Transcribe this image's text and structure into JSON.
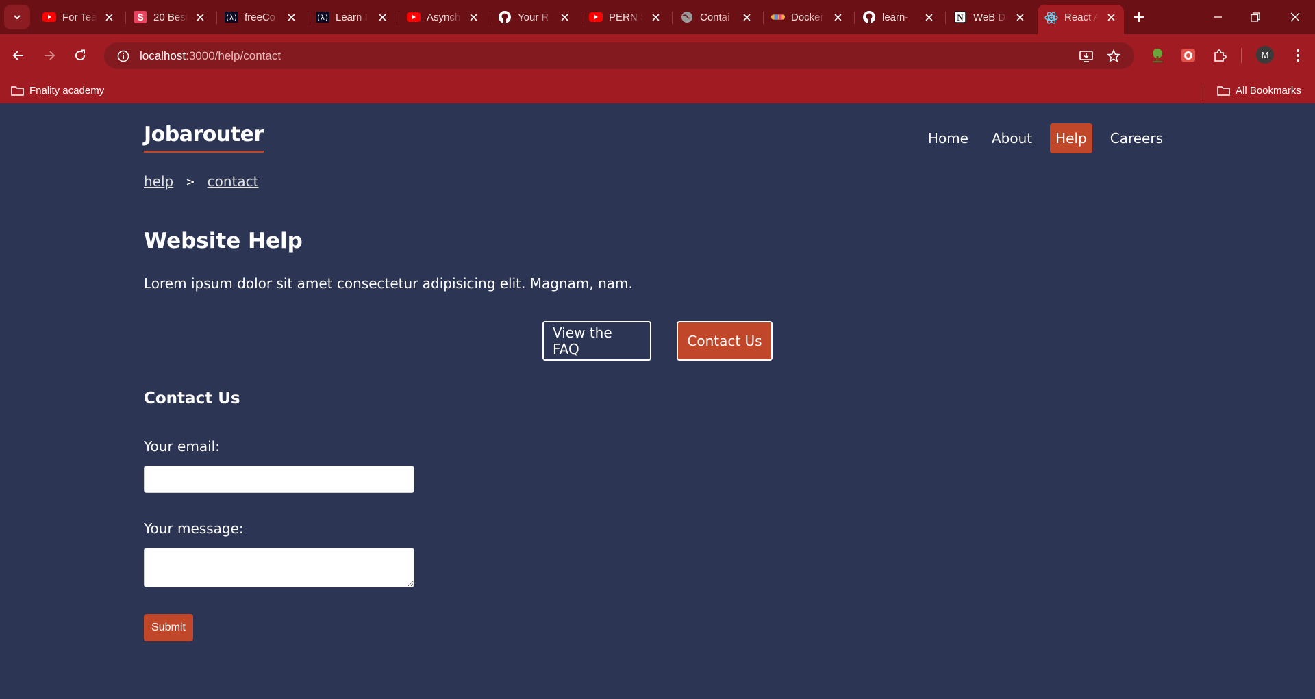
{
  "browser": {
    "tabs": [
      {
        "title": "For Tea",
        "icon": "youtube-icon"
      },
      {
        "title": "20 Best",
        "icon": "s-logo-icon"
      },
      {
        "title": "freeCo",
        "icon": "freecodecamp-icon"
      },
      {
        "title": "Learn I",
        "icon": "freecodecamp-icon"
      },
      {
        "title": "Asynch",
        "icon": "youtube-icon"
      },
      {
        "title": "Your R",
        "icon": "github-icon"
      },
      {
        "title": "PERN S",
        "icon": "youtube-icon"
      },
      {
        "title": "Contai",
        "icon": "globe-icon"
      },
      {
        "title": "Docker",
        "icon": "docker-icon"
      },
      {
        "title": "learn-",
        "icon": "github-icon"
      },
      {
        "title": "WeB D",
        "icon": "notion-icon"
      },
      {
        "title": "React A",
        "icon": "react-icon",
        "active": true
      }
    ],
    "url_host": "localhost",
    "url_path": ":3000/help/contact",
    "profile_initial": "M",
    "bookmark_folder": "Fnality academy",
    "all_bookmarks": "All Bookmarks"
  },
  "site": {
    "brand": "Jobarouter",
    "nav": {
      "home": "Home",
      "about": "About",
      "help": "Help",
      "careers": "Careers"
    },
    "breadcrumb": {
      "first": "help",
      "separator": ">",
      "second": "contact"
    },
    "title": "Website Help",
    "lede": "Lorem ipsum dolor sit amet consectetur adipisicing elit. Magnam, nam.",
    "buttons": {
      "faq": "View the FAQ",
      "contact": "Contact Us"
    },
    "section_title": "Contact Us",
    "form": {
      "email_label": "Your email:",
      "email_value": "",
      "message_label": "Your message:",
      "message_value": "",
      "submit_label": "Submit"
    }
  },
  "colors": {
    "page_bg": "#2c3554",
    "accent": "#c0472a",
    "browser_frame": "#a11c22",
    "tabstrip": "#6b1115"
  }
}
